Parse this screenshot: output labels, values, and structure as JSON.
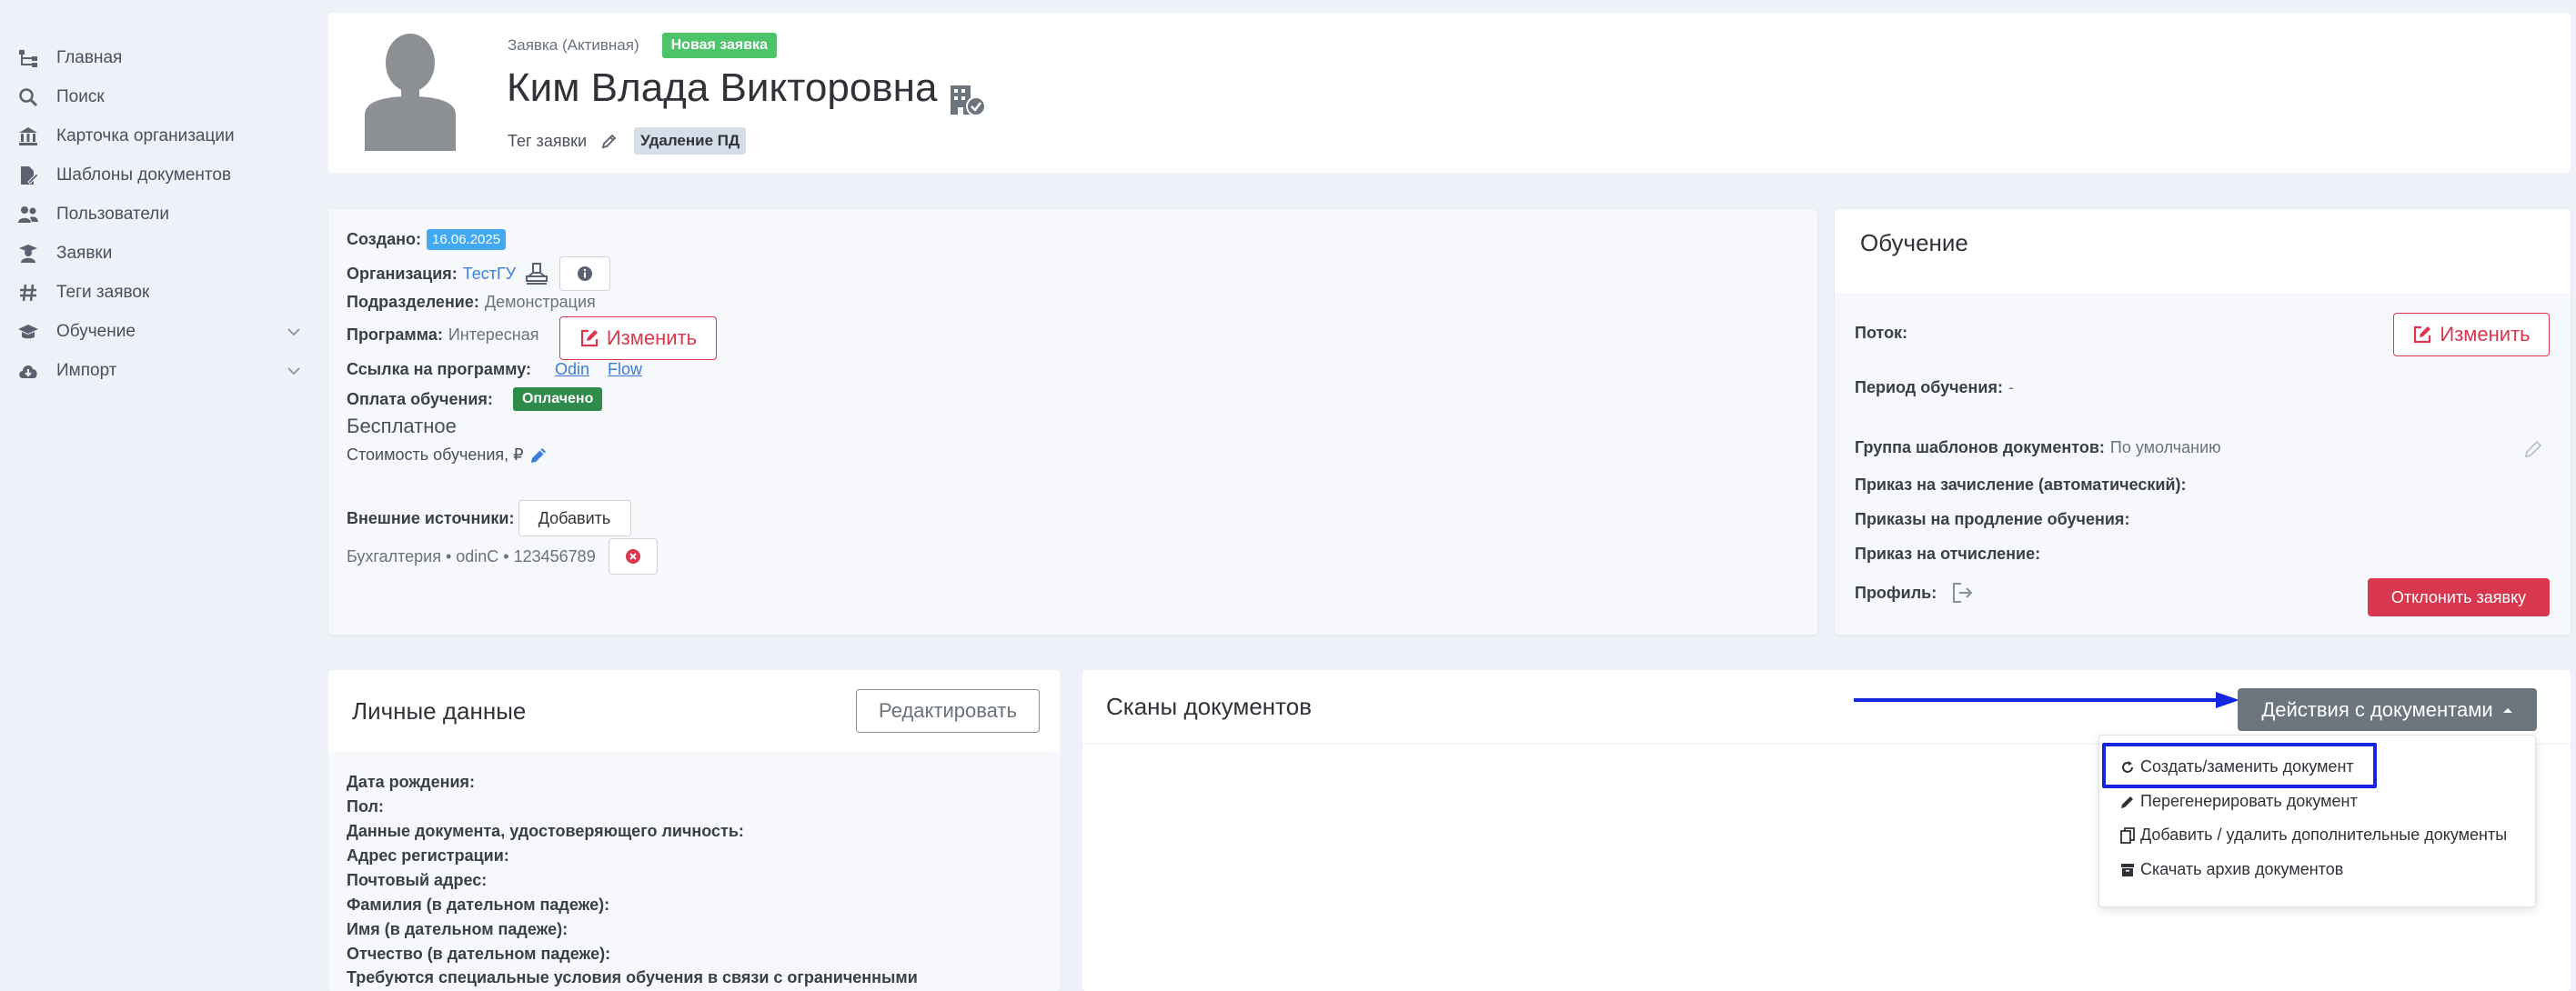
{
  "sidebar": {
    "items": [
      {
        "label": "Главная",
        "icon": "tree-icon"
      },
      {
        "label": "Поиск",
        "icon": "search-icon"
      },
      {
        "label": "Карточка организации",
        "icon": "bank-icon"
      },
      {
        "label": "Шаблоны документов",
        "icon": "file-edit-icon"
      },
      {
        "label": "Пользователи",
        "icon": "users-icon"
      },
      {
        "label": "Заявки",
        "icon": "graduate-icon"
      },
      {
        "label": "Теги заявок",
        "icon": "hashtag-icon"
      },
      {
        "label": "Обучение",
        "icon": "graduation-cap-icon"
      },
      {
        "label": "Импорт",
        "icon": "cloud-download-icon"
      }
    ]
  },
  "header": {
    "status": "Заявка (Активная)",
    "new_badge": "Новая заявка",
    "name": "Ким Влада Викторовна",
    "tag_label": "Тег заявки",
    "tag_value": "Удаление ПД"
  },
  "info": {
    "created_label": "Создано:",
    "created_value": "16.06.2025",
    "org_label": "Организация:",
    "org_value": "ТестГУ",
    "division_label": "Подразделение:",
    "division_value": "Демонстрация",
    "program_label": "Программа:",
    "program_value": "Интересная",
    "change_button": "Изменить",
    "program_link_label": "Ссылка на программу:",
    "link_odin": "Odin",
    "link_flow": "Flow",
    "payment_label": "Оплата обучения:",
    "payment_badge": "Оплачено",
    "payment_type": "Бесплатное",
    "cost_label": "Стоимость обучения, ₽",
    "external_label": "Внешние источники:",
    "add_button": "Добавить",
    "source_item": "Бухгалтерия • odinC • 123456789"
  },
  "training": {
    "title": "Обучение",
    "stream_label": "Поток:",
    "change_button": "Изменить",
    "period_label": "Период обучения:",
    "period_value": "-",
    "templates_label": "Группа шаблонов документов:",
    "templates_value": "По умолчанию",
    "enroll_label": "Приказ на зачисление (автоматический):",
    "extend_label": "Приказы на продление обучения:",
    "expel_label": "Приказ на отчисление:",
    "profile_label": "Профиль:",
    "reject_button": "Отклонить заявку"
  },
  "personal": {
    "title": "Личные данные",
    "edit_button": "Редактировать",
    "fields": [
      "Дата рождения:",
      "Пол:",
      "Данные документа, удостоверяющего личность:",
      "Адрес регистрации:",
      "Почтовый адрес:",
      "Фамилия (в дательном падеже):",
      "Имя (в дательном падеже):",
      "Отчество (в дательном падеже):",
      "Требуются специальные условия обучения в связи с ограниченными"
    ]
  },
  "scans": {
    "title": "Сканы документов",
    "actions_button": "Действия с документами",
    "menu": [
      {
        "label": "Создать/заменить документ",
        "icon": "refresh-icon"
      },
      {
        "label": "Перегенерировать документ",
        "icon": "pencil-icon"
      },
      {
        "label": "Добавить / удалить дополнительные документы",
        "icon": "copy-icon"
      },
      {
        "label": "Скачать архив документов",
        "icon": "archive-icon"
      }
    ]
  },
  "colors": {
    "accent_highlight": "#1526e0",
    "danger": "#d9374d",
    "success": "#4cc46a",
    "info": "#40a9f0"
  }
}
